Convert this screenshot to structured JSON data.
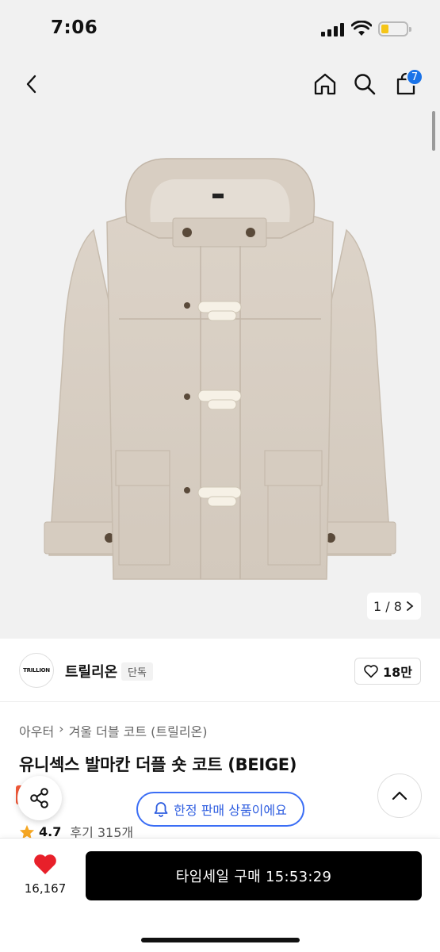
{
  "status_bar": {
    "time": "7:06"
  },
  "nav": {
    "cart_count": "7",
    "icons": [
      "back-icon",
      "home-icon",
      "search-icon",
      "cart-icon"
    ]
  },
  "gallery": {
    "pager_text": "1 / 8",
    "current_index": 1,
    "total": 8
  },
  "brand": {
    "name": "트릴리온",
    "tag": "단독",
    "logo_text": "TRILLION",
    "like_count": "18만"
  },
  "product": {
    "breadcrumb": [
      "아우터",
      "겨울 더블 코트 (트릴리온)"
    ],
    "title": "유니섹스 발마칸 더플 숏 코트 (BEIGE)",
    "sale_badge": "일",
    "rating": "4.7",
    "review_text": "후기 315개"
  },
  "floating": {
    "limited_label": "한정 판매 상품이에요"
  },
  "bottom": {
    "wish_count": "16,167",
    "buy_label": "타임세일 구매 15:53:29"
  },
  "colors": {
    "accent_blue": "#3b6ef5",
    "badge_blue": "#1a73e8",
    "heart_red": "#e8202a",
    "sale_red": "#f45a3a",
    "star": "#f5a623",
    "coat": "#d9cfc3"
  }
}
